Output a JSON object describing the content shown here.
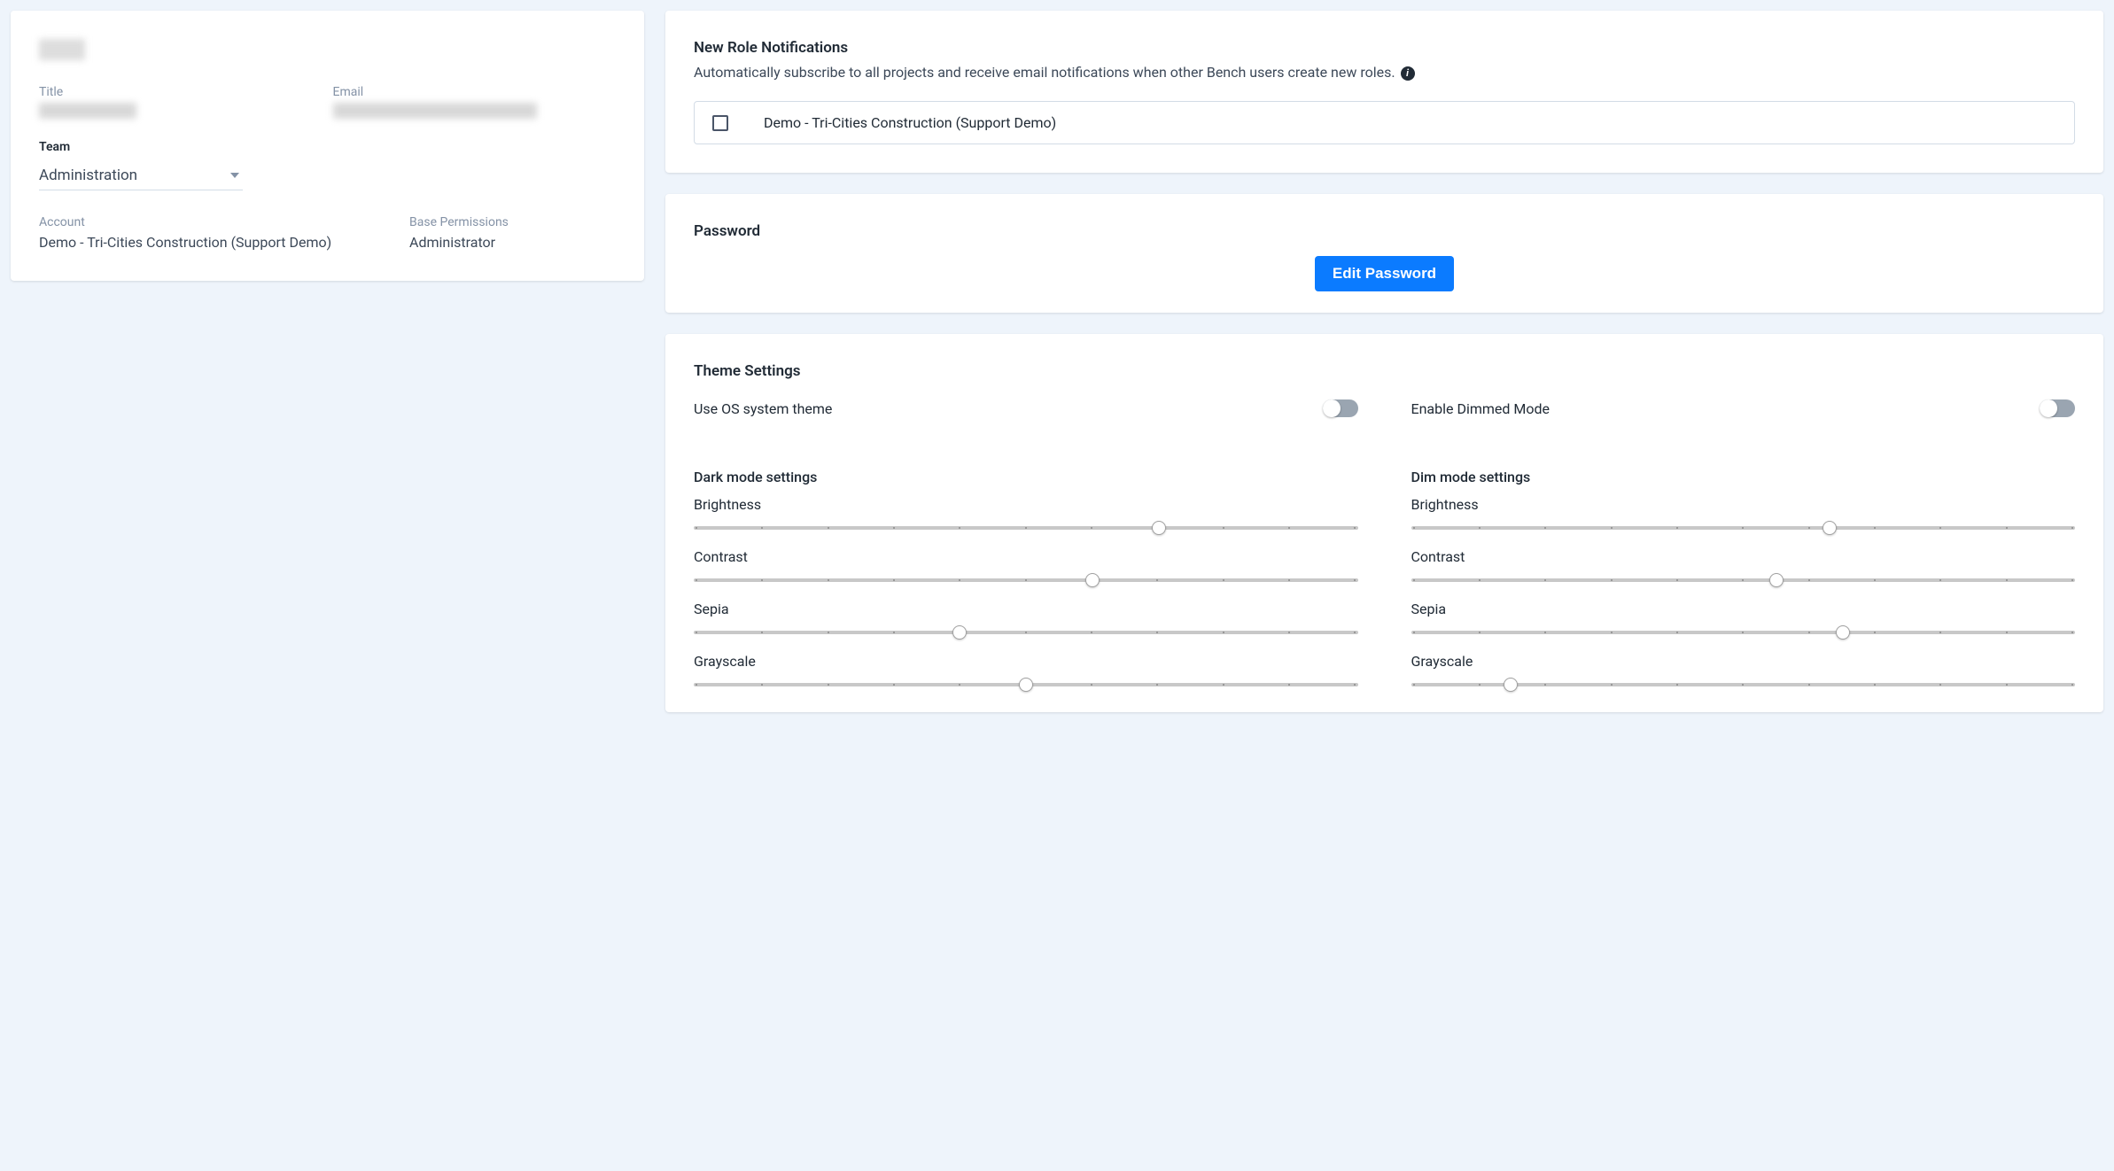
{
  "profile": {
    "title_label": "Title",
    "email_label": "Email",
    "team_label": "Team",
    "team_value": "Administration",
    "account_label": "Account",
    "account_value": "Demo - Tri-Cities Construction (Support Demo)",
    "permissions_label": "Base Permissions",
    "permissions_value": "Administrator"
  },
  "notifications": {
    "title": "New Role Notifications",
    "description_prefix": "Automatically subscribe to all projects and receive email notifications when other Bench users create new roles.",
    "item_label": "Demo - Tri-Cities Construction (Support Demo)",
    "item_checked": false
  },
  "password": {
    "title": "Password",
    "button_label": "Edit Password"
  },
  "theme": {
    "title": "Theme Settings",
    "use_os_label": "Use OS system theme",
    "use_os_enabled": false,
    "dimmed_label": "Enable Dimmed Mode",
    "dimmed_enabled": false,
    "dark": {
      "heading": "Dark mode settings",
      "brightness_label": "Brightness",
      "brightness_value": 70,
      "contrast_label": "Contrast",
      "contrast_value": 60,
      "sepia_label": "Sepia",
      "sepia_value": 40,
      "grayscale_label": "Grayscale",
      "grayscale_value": 50
    },
    "dim": {
      "heading": "Dim mode settings",
      "brightness_label": "Brightness",
      "brightness_value": 63,
      "contrast_label": "Contrast",
      "contrast_value": 55,
      "sepia_label": "Sepia",
      "sepia_value": 65,
      "grayscale_label": "Grayscale",
      "grayscale_value": 15
    }
  }
}
